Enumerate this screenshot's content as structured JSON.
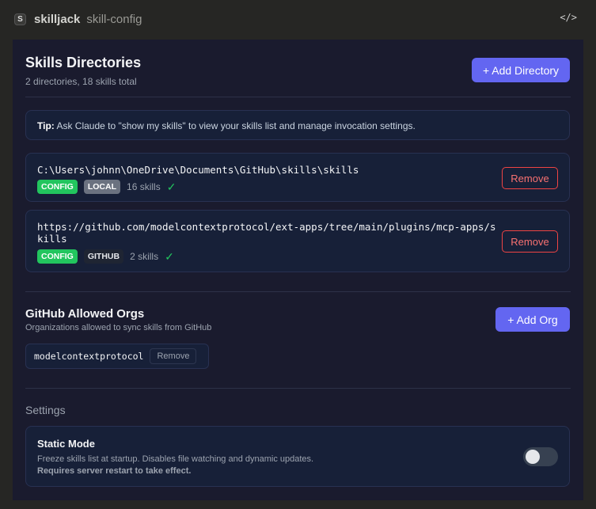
{
  "header": {
    "logo": "S",
    "app": "skilljack",
    "page": "skill-config",
    "code_icon": "</>"
  },
  "directories": {
    "title": "Skills Directories",
    "summary": "2 directories, 18 skills total",
    "add_label": "+ Add Directory",
    "tip_label": "Tip:",
    "tip_text": " Ask Claude to \"show my skills\" to view your skills list and manage invocation settings.",
    "items": [
      {
        "path": "C:\\Users\\johnn\\OneDrive\\Documents\\GitHub\\skills\\skills",
        "badge1": "CONFIG",
        "badge2": "LOCAL",
        "count": "16 skills",
        "check": "✓",
        "remove": "Remove"
      },
      {
        "path": "https://github.com/modelcontextprotocol/ext-apps/tree/main/plugins/mcp-apps/skills",
        "badge1": "CONFIG",
        "badge2": "GITHUB",
        "count": "2 skills",
        "check": "✓",
        "remove": "Remove"
      }
    ]
  },
  "orgs": {
    "title": "GitHub Allowed Orgs",
    "desc": "Organizations allowed to sync skills from GitHub",
    "add_label": "+ Add Org",
    "items": [
      {
        "name": "modelcontextprotocol",
        "remove": "Remove"
      }
    ]
  },
  "settings": {
    "title": "Settings",
    "static_mode": {
      "label": "Static Mode",
      "desc": "Freeze skills list at startup. Disables file watching and dynamic updates.",
      "warning": "Requires server restart to take effect.",
      "enabled": false
    }
  }
}
